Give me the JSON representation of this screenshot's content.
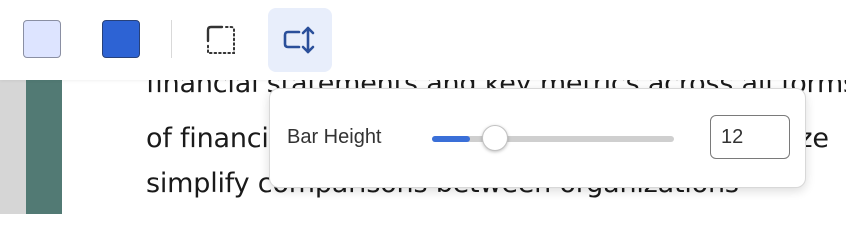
{
  "toolbar": {
    "swatches": [
      {
        "name": "light",
        "color": "#dde4ff"
      },
      {
        "name": "dark",
        "color": "#2d63d4"
      }
    ],
    "tools": [
      {
        "icon": "dotted-border-icon",
        "active": false
      },
      {
        "icon": "bar-height-icon",
        "active": true
      }
    ]
  },
  "document": {
    "lines": [
      "financial statements and key metrics across all forms",
      "of financial reporting, these tools aim to harmonize",
      "simplify comparisons between organizations"
    ]
  },
  "popover": {
    "label": "Bar Height",
    "slider": {
      "value": 12,
      "min": 0,
      "max": 100
    },
    "input_value": "12"
  },
  "colors": {
    "accent": "#3a6fd8",
    "active_tool_bg": "#e8eefb",
    "gutter_teal": "#527a74"
  }
}
